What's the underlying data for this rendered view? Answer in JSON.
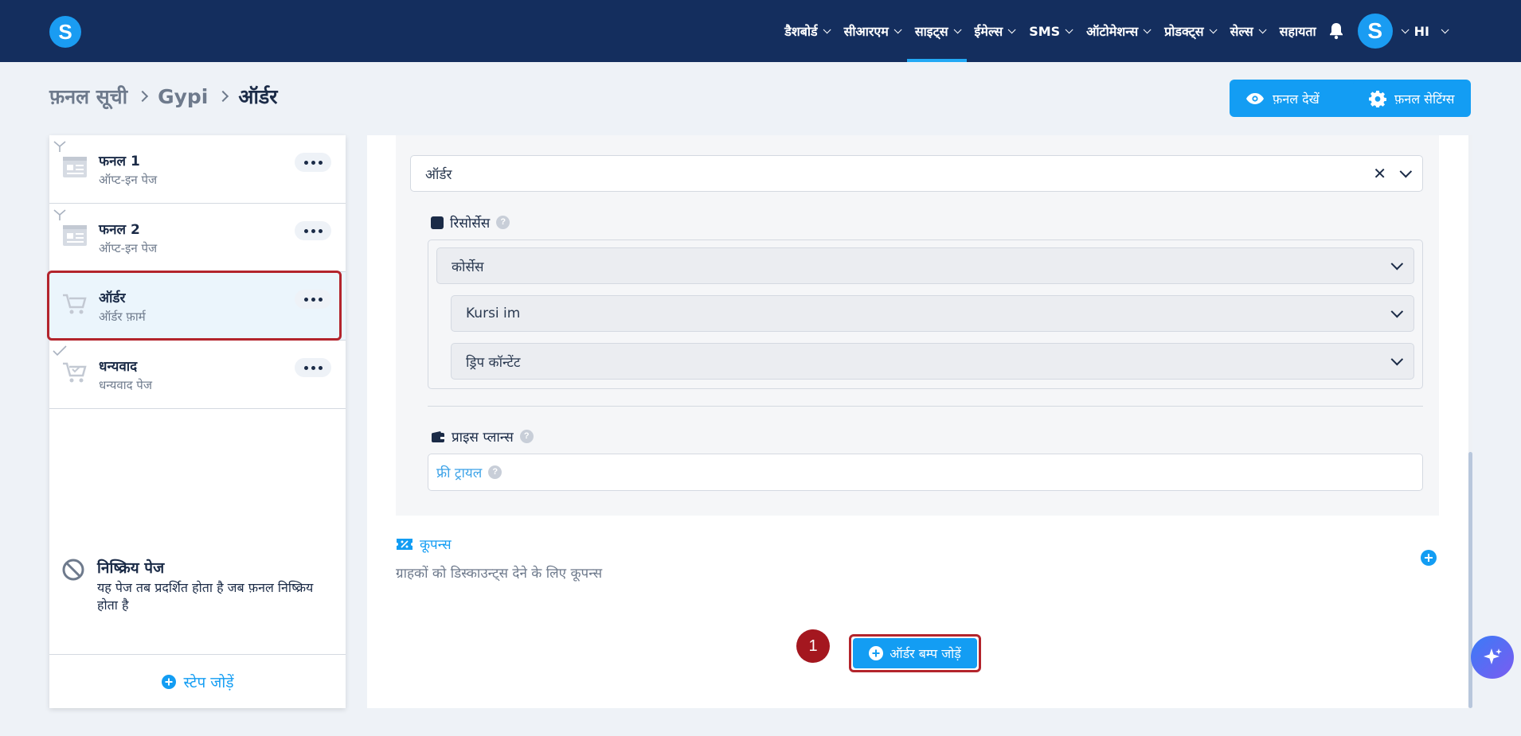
{
  "nav": {
    "items": [
      {
        "label": "डैशबोर्ड",
        "active": false
      },
      {
        "label": "सीआरएम",
        "active": false
      },
      {
        "label": "साइट्स",
        "active": true
      },
      {
        "label": "ईमेल्स",
        "active": false
      },
      {
        "label": "SMS",
        "active": false
      },
      {
        "label": "ऑटोमेशन्स",
        "active": false
      },
      {
        "label": "प्रोडक्ट्स",
        "active": false
      },
      {
        "label": "सेल्स",
        "active": false
      }
    ],
    "help": "सहायता",
    "avatar_letter": "S",
    "language": "HI",
    "logo_letter": "S"
  },
  "breadcrumb": [
    "फ़नल सूची",
    "Gypi",
    "ऑर्डर"
  ],
  "actions": {
    "view_funnel": "फ़नल देखें",
    "funnel_settings": "फ़नल सेटिंग्स"
  },
  "steps": [
    {
      "title": "फनल 1",
      "subtitle": "ऑप्ट-इन पेज"
    },
    {
      "title": "फनल 2",
      "subtitle": "ऑप्ट-इन पेज"
    },
    {
      "title": "ऑर्डर",
      "subtitle": "ऑर्डर फ़ार्म"
    },
    {
      "title": "धन्यवाद",
      "subtitle": "धन्यवाद पेज"
    }
  ],
  "inactive": {
    "title": "निष्क्रिय पेज",
    "description": "यह पेज तब प्रदर्शित होता है जब फ़नल निष्क्रिय होता है"
  },
  "add_step": "स्टेप जोड़ें",
  "main": {
    "product_select": "ऑर्डर",
    "resources_label": "रिसोर्सेस",
    "courses_label": "कोर्सेस",
    "course_item": "Kursi im",
    "drip_label": "ड्रिप कॉन्टेंट",
    "price_plans_label": "प्राइस प्लान्स",
    "free_trial": "फ्री ट्रायल",
    "coupons_title": "कूपन्स",
    "coupons_desc": "ग्राहकों को डिस्काउन्ट्स देने के लिए कूपन्स",
    "add_order_bump": "ऑर्डर बम्प जोड़ें",
    "step_badge": "1"
  },
  "colors": {
    "nav_bg": "#142e5e",
    "accent": "#139df3",
    "highlight": "#b3242c"
  }
}
